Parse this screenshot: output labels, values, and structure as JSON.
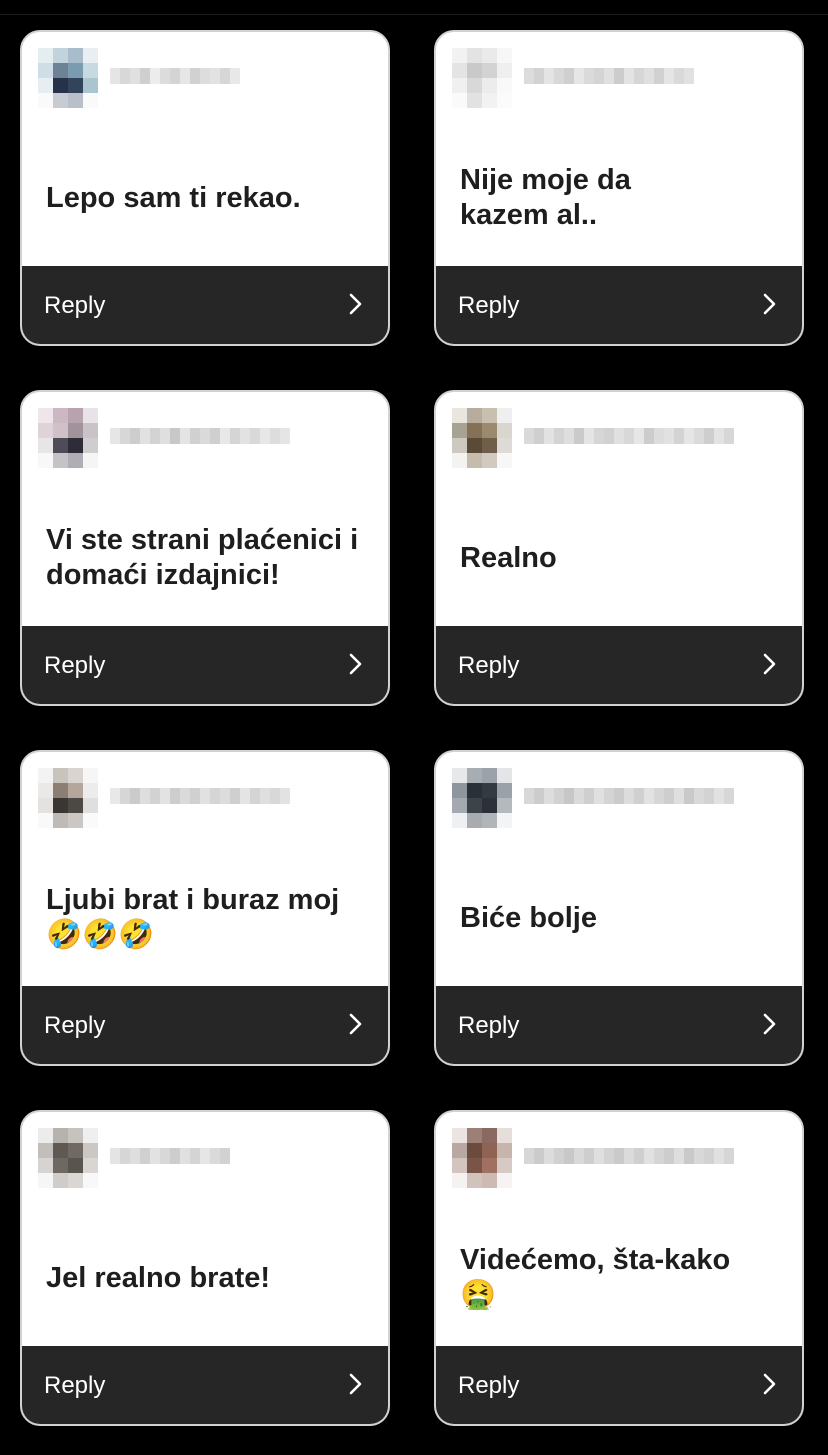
{
  "cards": [
    {
      "message": "Lepo sam ti rekao.",
      "reply_label": "Reply",
      "chevron_icon": "chevron-right-icon"
    },
    {
      "message": "Nije moje da\nkazem al..",
      "reply_label": "Reply",
      "chevron_icon": "chevron-right-icon"
    },
    {
      "message": "Vi ste strani plaćenici i\ndomaći izdajnici!",
      "reply_label": "Reply",
      "chevron_icon": "chevron-right-icon"
    },
    {
      "message": "Realno",
      "reply_label": "Reply",
      "chevron_icon": "chevron-right-icon"
    },
    {
      "message": "Ljubi brat i buraz moj\n🤣🤣🤣",
      "reply_label": "Reply",
      "chevron_icon": "chevron-right-icon"
    },
    {
      "message": "Biće bolje",
      "reply_label": "Reply",
      "chevron_icon": "chevron-right-icon"
    },
    {
      "message": "Jel realno brate!",
      "reply_label": "Reply",
      "chevron_icon": "chevron-right-icon"
    },
    {
      "message": "Videćemo,  šta-kako\n🤮",
      "reply_label": "Reply",
      "chevron_icon": "chevron-right-icon"
    }
  ],
  "colors": {
    "background": "#000000",
    "card": "#ffffff",
    "card_border": "#d2d2d2",
    "reply_bar": "#262626",
    "text": "#1e1e1e"
  }
}
